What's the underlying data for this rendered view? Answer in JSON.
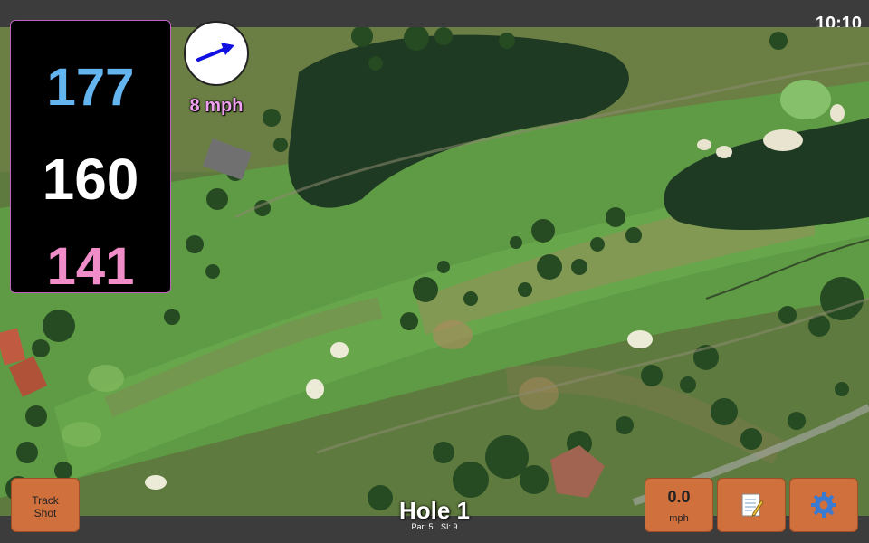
{
  "status_bar": {
    "time": "10:10"
  },
  "distances": {
    "back": "177",
    "middle": "160",
    "front": "141"
  },
  "wind": {
    "speed_label": "8 mph",
    "direction": "east-northeast"
  },
  "buttons": {
    "track_shot": {
      "line1": "Track",
      "line2": "Shot"
    },
    "speed": {
      "value": "0.0",
      "unit": "mph"
    },
    "notes_icon": "notepad-icon",
    "settings_icon": "gear-icon"
  },
  "hole": {
    "title": "Hole 1",
    "par": "Par: 5",
    "si": "SI: 9"
  },
  "colors": {
    "back": "#64b4f0",
    "middle": "#ffffff",
    "front": "#f08cc8",
    "wind_text": "#f0a0f0",
    "button": "#d0703c",
    "wind_arrow": "#1010e0"
  }
}
